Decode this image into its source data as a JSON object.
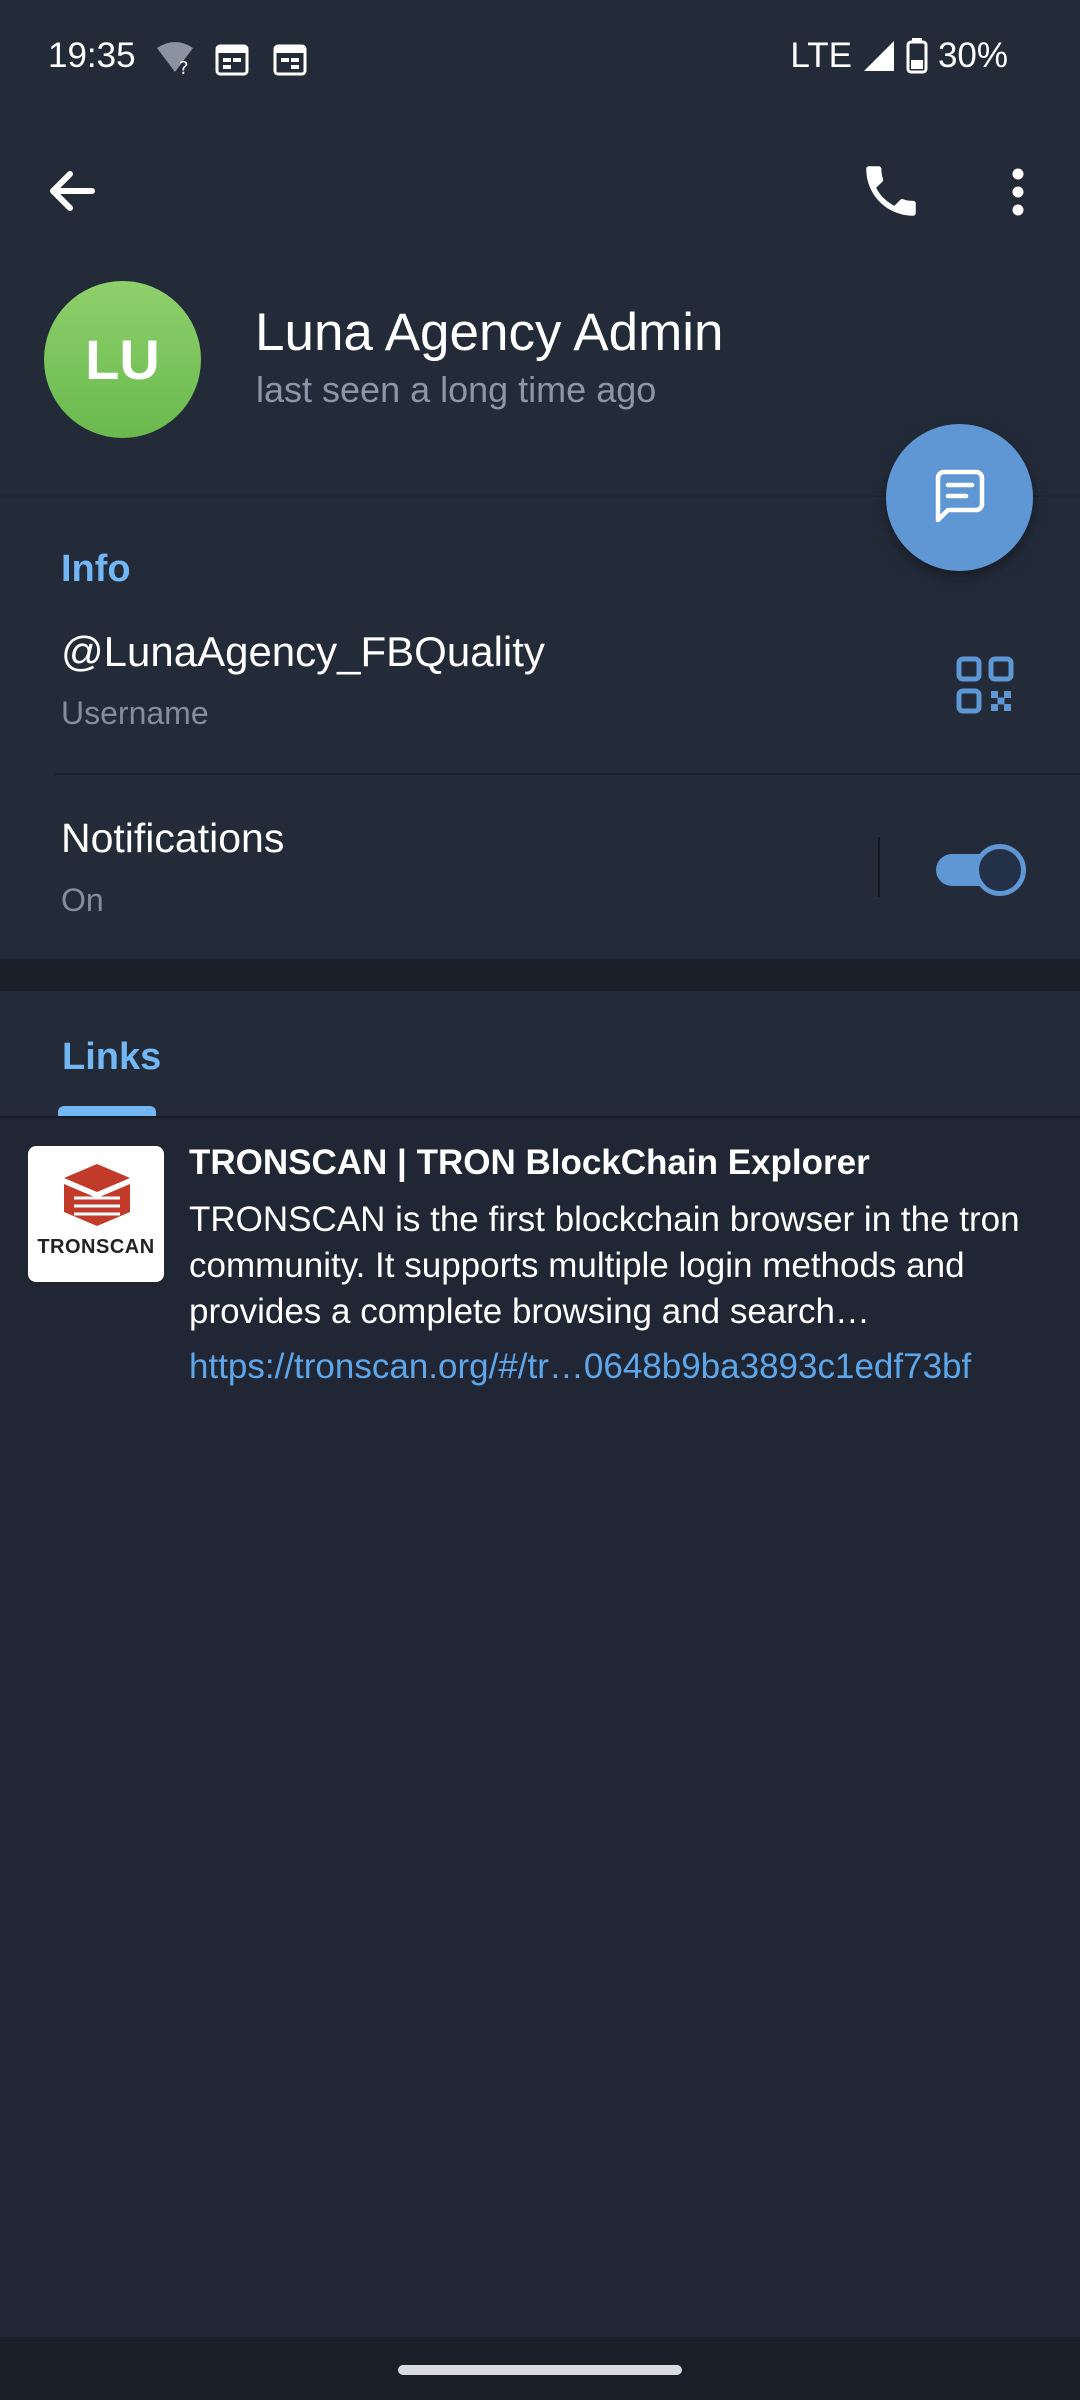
{
  "status_bar": {
    "time": "19:35",
    "network": "LTE",
    "battery": "30%",
    "icons": [
      "wifi-question-icon",
      "calendar-icon",
      "calendar-icon",
      "signal-icon",
      "battery-icon"
    ]
  },
  "toolbar": {
    "back_icon": "arrow-back-icon",
    "call_icon": "phone-icon",
    "more_icon": "more-vert-icon"
  },
  "profile": {
    "initials": "LU",
    "name": "Luna Agency Admin",
    "last_seen": "last seen a long time ago",
    "avatar_color": "#7cc55c"
  },
  "fab": {
    "icon": "message-icon"
  },
  "info": {
    "title": "Info",
    "username": "@LunaAgency_FBQuality",
    "username_label": "Username",
    "qr_icon": "qr-code-icon",
    "notifications_label": "Notifications",
    "notifications_value": "On",
    "notifications_enabled": true
  },
  "links": {
    "tab_label": "Links",
    "items": [
      {
        "thumb_text": "TRONSCAN",
        "title": "TRONSCAN | TRON BlockChain Explorer",
        "description": "TRONSCAN is the first blockchain browser in the tron community. It supports multiple login methods and provides a complete browsing and search…",
        "url": "https://tronscan.org/#/tr…0648b9ba3893c1edf73bf"
      }
    ]
  },
  "colors": {
    "accent": "#5f96d4",
    "link": "#5ea6ea",
    "section_title": "#72b6f4",
    "background": "#202633"
  }
}
